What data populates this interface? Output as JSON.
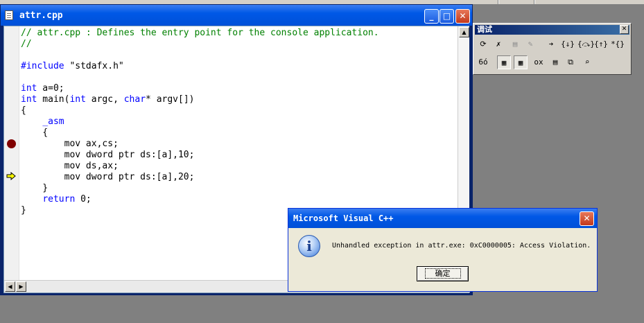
{
  "editor": {
    "title": "attr.cpp",
    "code_lines": [
      {
        "segments": [
          {
            "text": "// attr.cpp : Defines the entry point for the console application.",
            "cls": "c-comment"
          }
        ]
      },
      {
        "segments": [
          {
            "text": "//",
            "cls": "c-comment"
          }
        ]
      },
      {
        "segments": []
      },
      {
        "segments": [
          {
            "text": "#include",
            "cls": "c-kw"
          },
          {
            "text": " \"stdafx.h\"",
            "cls": ""
          }
        ]
      },
      {
        "segments": []
      },
      {
        "segments": [
          {
            "text": "int",
            "cls": "c-kw"
          },
          {
            "text": " a=0;",
            "cls": ""
          }
        ]
      },
      {
        "segments": [
          {
            "text": "int",
            "cls": "c-kw"
          },
          {
            "text": " main(",
            "cls": ""
          },
          {
            "text": "int",
            "cls": "c-kw"
          },
          {
            "text": " argc, ",
            "cls": ""
          },
          {
            "text": "char",
            "cls": "c-kw"
          },
          {
            "text": "* argv[])",
            "cls": ""
          }
        ]
      },
      {
        "segments": [
          {
            "text": "{",
            "cls": ""
          }
        ]
      },
      {
        "segments": [
          {
            "text": "    ",
            "cls": ""
          },
          {
            "text": "_asm",
            "cls": "c-kw"
          }
        ]
      },
      {
        "segments": [
          {
            "text": "    {",
            "cls": ""
          }
        ]
      },
      {
        "segments": [
          {
            "text": "        mov ax,cs;",
            "cls": ""
          }
        ]
      },
      {
        "segments": [
          {
            "text": "        mov dword ptr ds:[a],10;",
            "cls": ""
          }
        ]
      },
      {
        "segments": [
          {
            "text": "        mov ds,ax;",
            "cls": ""
          }
        ]
      },
      {
        "segments": [
          {
            "text": "        mov dword ptr ds:[a],20;",
            "cls": ""
          }
        ]
      },
      {
        "segments": [
          {
            "text": "    }",
            "cls": ""
          }
        ]
      },
      {
        "segments": [
          {
            "text": "    ",
            "cls": ""
          },
          {
            "text": "return",
            "cls": "c-kw"
          },
          {
            "text": " 0;",
            "cls": ""
          }
        ]
      },
      {
        "segments": [
          {
            "text": "}",
            "cls": ""
          }
        ]
      }
    ]
  },
  "debug_toolbar": {
    "title": "调试",
    "row1": [
      {
        "name": "restart-icon",
        "glyph": "⟳",
        "dim": false
      },
      {
        "name": "stop-debugging-icon",
        "glyph": "✗",
        "dim": false
      },
      {
        "name": "break-execution-icon",
        "glyph": "▤",
        "dim": true
      },
      {
        "name": "apply-code-changes-icon",
        "glyph": "✎",
        "dim": true
      },
      {
        "name": "show-next-statement-icon",
        "glyph": "➔",
        "dim": false
      },
      {
        "name": "step-into-icon",
        "glyph": "{↓}",
        "dim": false
      },
      {
        "name": "step-over-icon",
        "glyph": "{⤼}",
        "dim": false
      },
      {
        "name": "step-out-icon",
        "glyph": "{↑}",
        "dim": false
      },
      {
        "name": "run-to-cursor-icon",
        "glyph": "*{}",
        "dim": false
      }
    ],
    "row2": [
      {
        "name": "quickwatch-icon",
        "glyph": "6ó",
        "pressed": false
      },
      {
        "name": "watch-icon",
        "glyph": "▦",
        "pressed": true
      },
      {
        "name": "variables-icon",
        "glyph": "▦",
        "pressed": true
      },
      {
        "name": "registers-icon",
        "glyph": "ox",
        "pressed": false
      },
      {
        "name": "memory-icon",
        "glyph": "▤",
        "pressed": false
      },
      {
        "name": "call-stack-icon",
        "glyph": "⧉",
        "pressed": false
      },
      {
        "name": "disassembly-icon",
        "glyph": "⌕",
        "pressed": false
      }
    ]
  },
  "message_box": {
    "title": "Microsoft Visual C++",
    "text": "Unhandled exception in attr.exe: 0xC0000005: Access Violation.",
    "ok_label": "确定",
    "icon": "info-icon"
  }
}
